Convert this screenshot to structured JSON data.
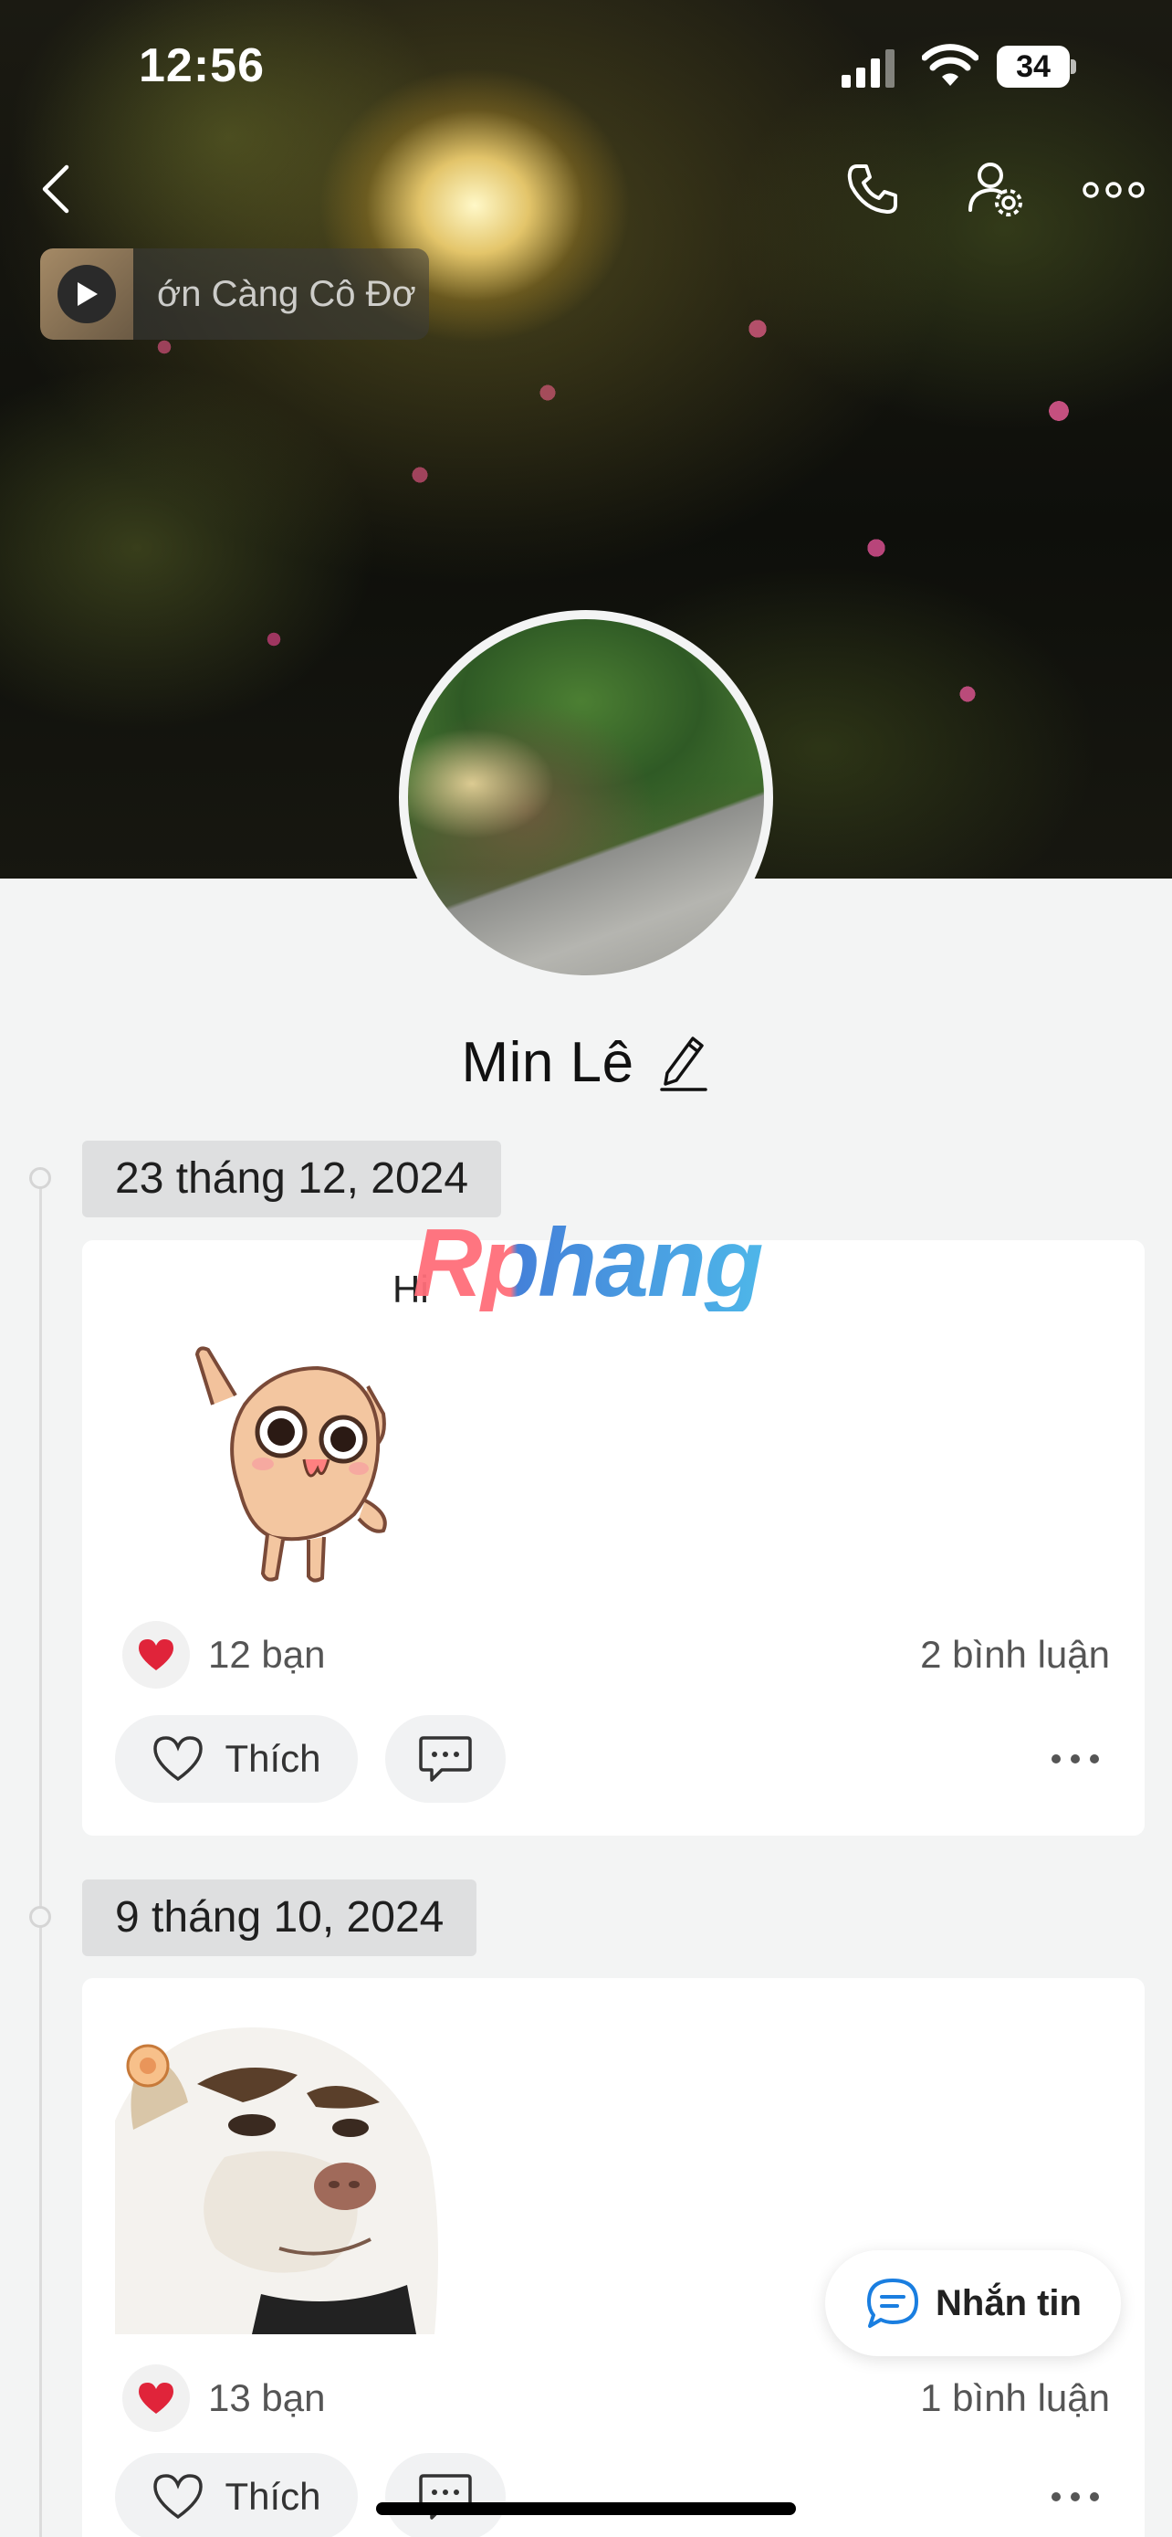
{
  "status_bar": {
    "time": "12:56",
    "battery": "34"
  },
  "header": {
    "music_title": "ớn Càng Cô Đơ"
  },
  "profile": {
    "name": "Min Lê"
  },
  "posts": [
    {
      "date": "23 tháng 12, 2024",
      "text": "Hi",
      "sticker": "waving-cat-sticker",
      "likes": "12 bạn",
      "comments": "2 bình luận",
      "like_label": "Thích"
    },
    {
      "date": "9 tháng 10, 2024",
      "sticker": "smug-dog-sticker",
      "likes": "13 bạn",
      "comments": "1 bình luận",
      "like_label": "Thích"
    }
  ],
  "watermark": "Rphang",
  "message_button": {
    "label": "Nhắn tin"
  },
  "colors": {
    "accent": "#1a7ee0",
    "heart": "#e0243a",
    "background": "#f3f4f4"
  }
}
